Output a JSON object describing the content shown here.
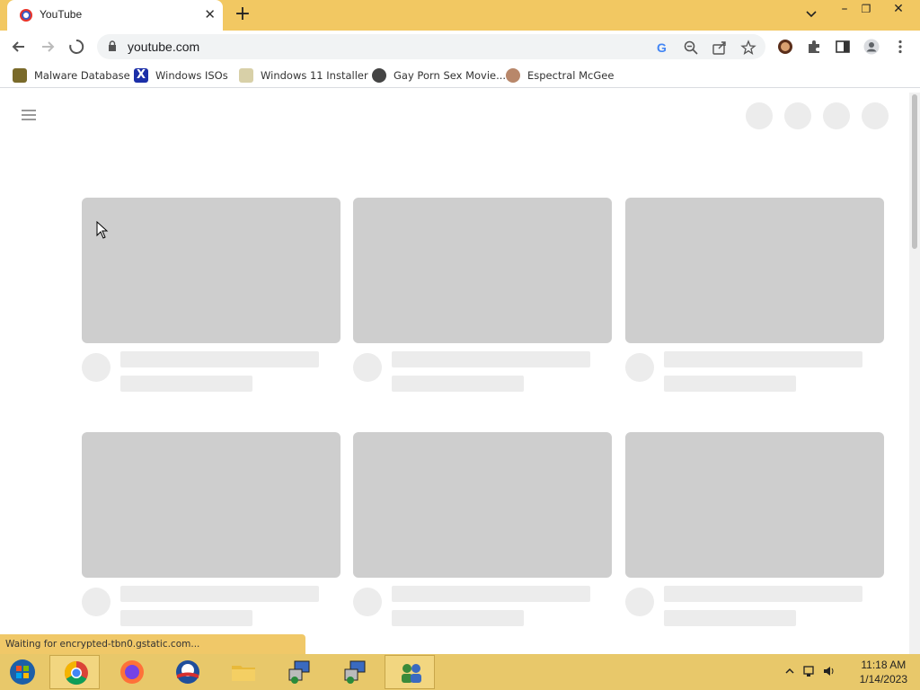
{
  "browser": {
    "tab_title": "YouTube",
    "url": "youtube.com"
  },
  "bookmarks": [
    {
      "label": "Malware Database"
    },
    {
      "label": "Windows ISOs"
    },
    {
      "label": "Windows 11 Installer"
    },
    {
      "label": "Gay Porn Sex Movie..."
    },
    {
      "label": "Espectral McGee"
    }
  ],
  "status_bar": {
    "text": "Waiting for encrypted-tbn0.gstatic.com..."
  },
  "taskbar": {
    "time": "11:18 AM",
    "date": "1/14/2023",
    "apps": [
      "start-orb",
      "chrome",
      "firefox",
      "obama-app",
      "file-explorer",
      "network-app-1",
      "network-app-2",
      "users-app"
    ]
  },
  "colors": {
    "tab_strip": "#f2c862",
    "taskbar": "#e8c86a",
    "skeleton_thumb": "#cecece",
    "skeleton_line": "#ececec"
  }
}
